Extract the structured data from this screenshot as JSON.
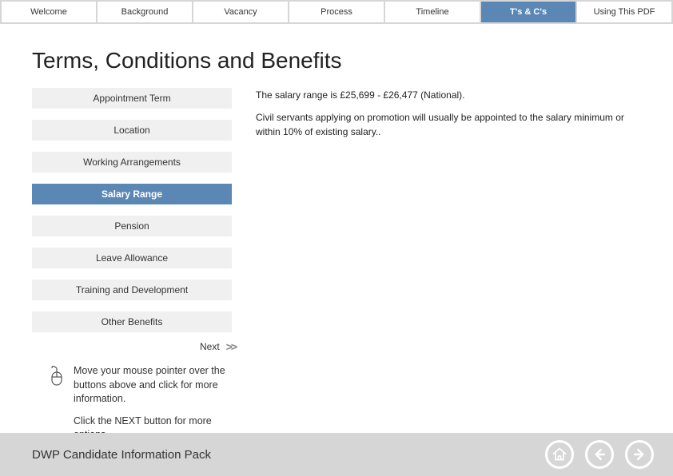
{
  "tabs": [
    {
      "label": "Welcome",
      "active": false
    },
    {
      "label": "Background",
      "active": false
    },
    {
      "label": "Vacancy",
      "active": false
    },
    {
      "label": "Process",
      "active": false
    },
    {
      "label": "Timeline",
      "active": false
    },
    {
      "label": "T's & C's",
      "active": true
    },
    {
      "label": "Using This PDF",
      "active": false
    }
  ],
  "page_title": "Terms, Conditions and Benefits",
  "sidebar": {
    "items": [
      {
        "label": "Appointment Term",
        "active": false
      },
      {
        "label": "Location",
        "active": false
      },
      {
        "label": "Working Arrangements",
        "active": false
      },
      {
        "label": "Salary Range",
        "active": true
      },
      {
        "label": "Pension",
        "active": false
      },
      {
        "label": "Leave Allowance",
        "active": false
      },
      {
        "label": "Training and Development",
        "active": false
      },
      {
        "label": "Other Benefits",
        "active": false
      }
    ]
  },
  "body": {
    "p1": "The salary range is £25,699 - £26,477 (National).",
    "p2": "Civil servants applying on promotion will usually be appointed to the salary minimum or within 10% of existing salary.."
  },
  "next": {
    "label": "Next",
    "arrow": ">>"
  },
  "hint": {
    "p1": "Move your mouse pointer over the buttons above and click for more information.",
    "p2": "Click the NEXT button for more options."
  },
  "footer": {
    "title": "DWP Candidate Information Pack"
  }
}
